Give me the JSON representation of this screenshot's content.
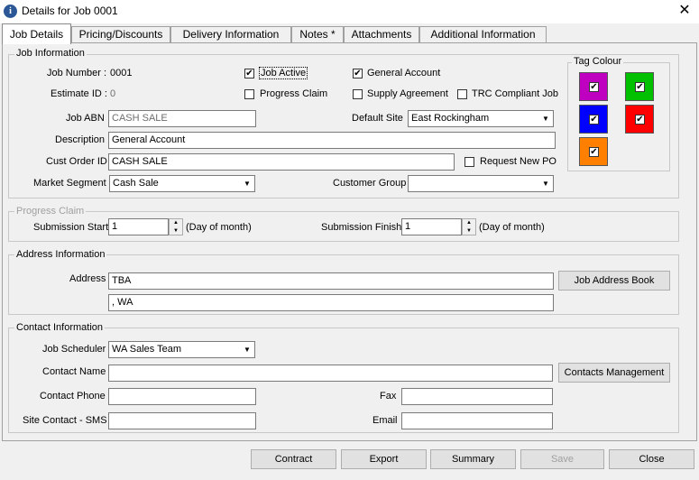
{
  "window": {
    "title": "Details for Job 0001",
    "info_icon": "i",
    "close_glyph": "✕"
  },
  "tabs": [
    {
      "label": "Job Details"
    },
    {
      "label": "Pricing/Discounts"
    },
    {
      "label": "Delivery Information"
    },
    {
      "label": "Notes *"
    },
    {
      "label": "Attachments"
    },
    {
      "label": "Additional Information"
    }
  ],
  "job_info": {
    "group_title": "Job Information",
    "job_number_label": "Job Number :",
    "job_number": "0001",
    "estimate_id_label": "Estimate ID :",
    "estimate_id": "0",
    "job_abn_label": "Job ABN",
    "job_abn": "CASH SALE",
    "description_label": "Description",
    "description": "General Account",
    "cust_order_label": "Cust Order ID",
    "cust_order": "CASH SALE",
    "market_segment_label": "Market Segment",
    "market_segment": "Cash Sale",
    "customer_group_label": "Customer Group",
    "customer_group": "",
    "default_site_label": "Default Site",
    "default_site": "East Rockingham",
    "job_active_label": "Job Active",
    "job_active": true,
    "general_account_label": "General Account",
    "general_account": true,
    "progress_claim_label": "Progress Claim",
    "progress_claim": false,
    "supply_agreement_label": "Supply Agreement",
    "supply_agreement": false,
    "trc_label": "TRC Compliant Job",
    "trc": false,
    "request_po_label": "Request New PO",
    "request_po": false
  },
  "tag_colour": {
    "title": "Tag Colour",
    "colors": [
      "#c000c0",
      "#00c000",
      "#0000ff",
      "#ff0000",
      "#ff8000"
    ],
    "check_glyph": "✔"
  },
  "progress": {
    "group_title": "Progress Claim",
    "start_label": "Submission Start",
    "start_value": "1",
    "start_hint": "(Day of month)",
    "finish_label": "Submission Finish",
    "finish_value": "1",
    "finish_hint": "(Day of month)"
  },
  "address": {
    "group_title": "Address Information",
    "label": "Address",
    "line1": "TBA",
    "line2": ", WA",
    "book_button": "Job Address Book"
  },
  "contact": {
    "group_title": "Contact Information",
    "scheduler_label": "Job Scheduler",
    "scheduler": "WA Sales Team",
    "name_label": "Contact Name",
    "name": "",
    "phone_label": "Contact Phone",
    "phone": "",
    "sms_label": "Site Contact - SMS",
    "sms": "",
    "fax_label": "Fax",
    "fax": "",
    "email_label": "Email",
    "email": "",
    "manage_button": "Contacts Management"
  },
  "footer": {
    "contract": "Contract",
    "export": "Export",
    "summary": "Summary",
    "save": "Save",
    "close": "Close"
  },
  "glyphs": {
    "dropdown": "▼",
    "up": "▲",
    "down": "▼",
    "check": "✔"
  }
}
